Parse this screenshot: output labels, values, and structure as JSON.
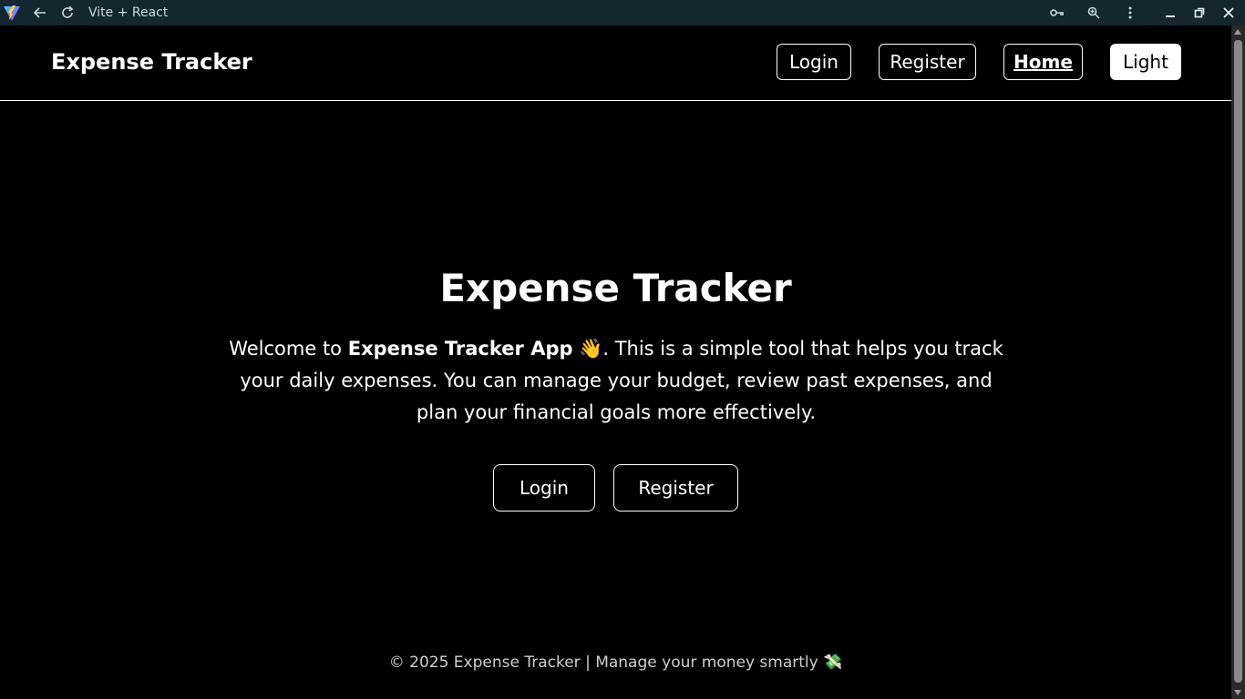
{
  "browser": {
    "tab_title": "Vite + React",
    "icons": {
      "logo": "vite-logo-icon",
      "back": "arrow-left-icon",
      "reload": "reload-icon",
      "key": "key-icon",
      "zoom": "zoom-icon",
      "menu": "kebab-menu-icon",
      "minimize": "minimize-icon",
      "maximize": "maximize-icon",
      "close": "close-icon"
    }
  },
  "header": {
    "brand": "Expense Tracker",
    "nav": {
      "login": "Login",
      "register": "Register",
      "home": "Home",
      "theme_toggle": "Light"
    }
  },
  "hero": {
    "title": "Expense Tracker",
    "text_prefix": "Welcome to ",
    "text_bold": "Expense Tracker App",
    "text_emoji": "👋",
    "text_suffix": ". This is a simple tool that helps you track your daily expenses. You can manage your budget, review past expenses, and plan your financial goals more effectively.",
    "login_button": "Login",
    "register_button": "Register"
  },
  "footer": {
    "text": "© 2025 Expense Tracker | Manage your money smartly 💸"
  },
  "colors": {
    "background": "#000000",
    "foreground": "#ffffff",
    "chrome_bar": "#15262e"
  }
}
